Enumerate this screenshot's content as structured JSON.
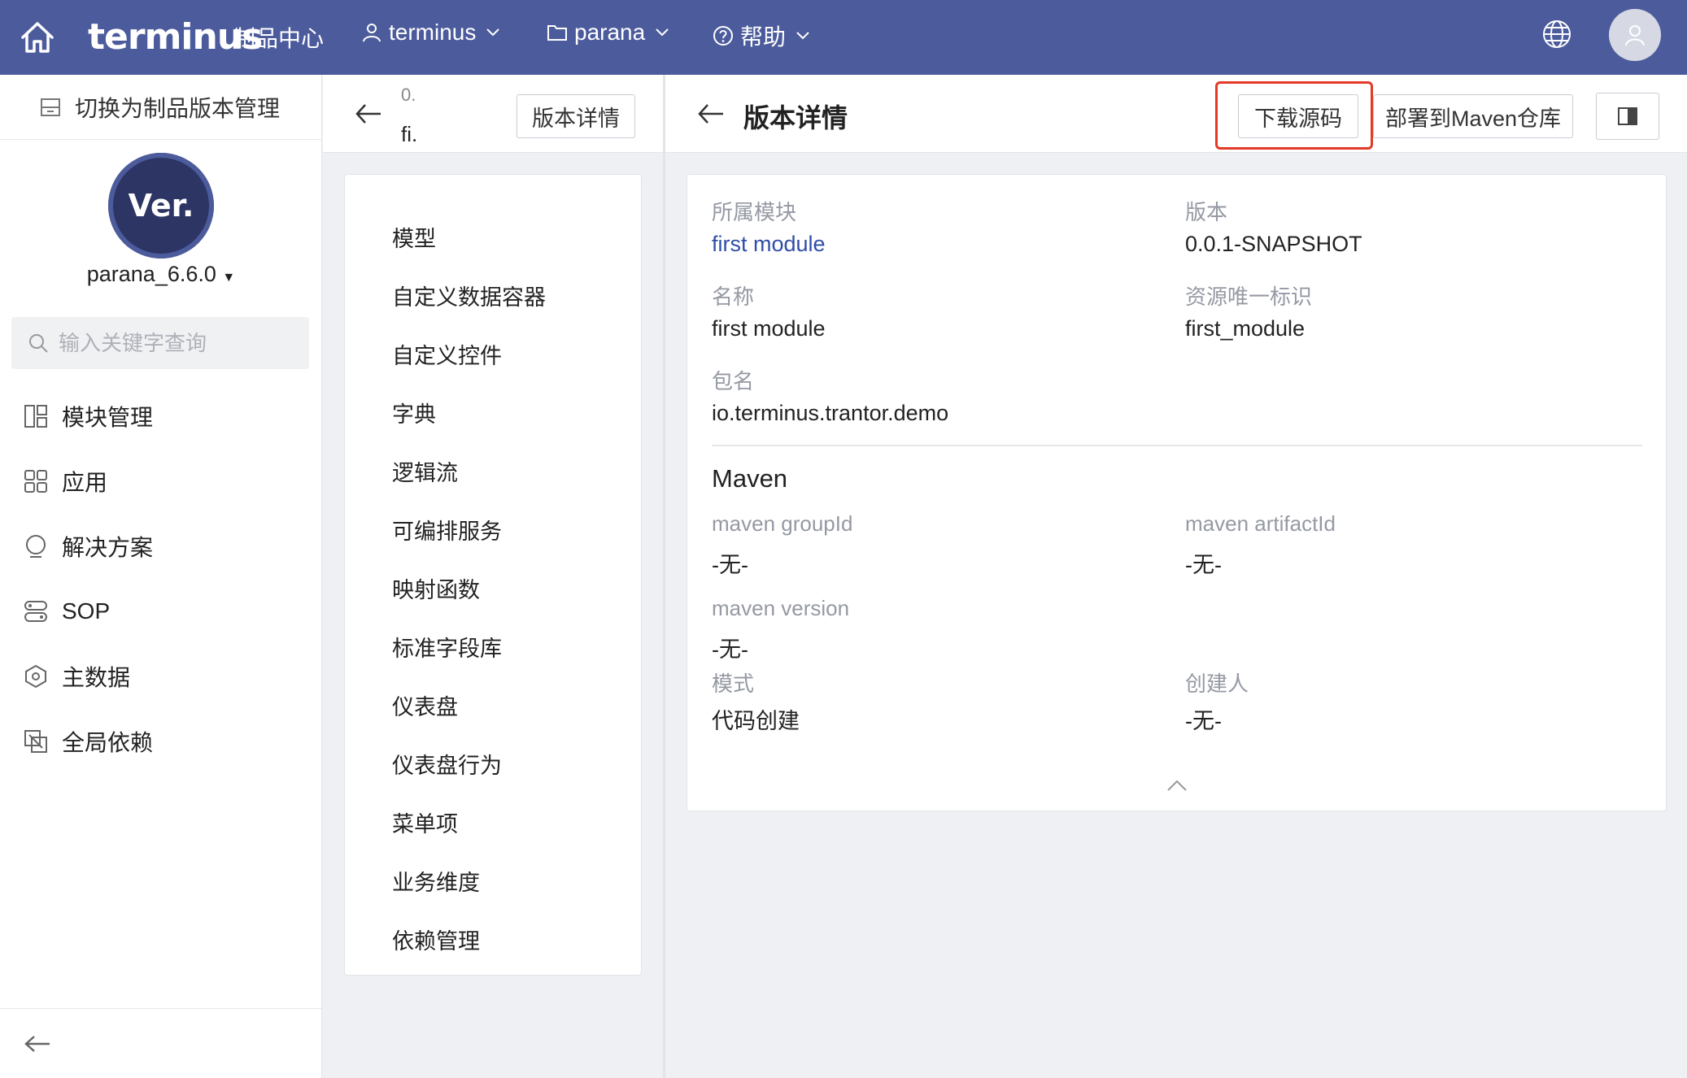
{
  "topbar": {
    "brand": "terminus",
    "brand_sub": "制品中心",
    "nav": [
      {
        "label": "terminus",
        "icon": "user-icon"
      },
      {
        "label": "parana",
        "icon": "folder-icon"
      },
      {
        "label": "帮助",
        "icon": "help-icon"
      }
    ]
  },
  "sidebar": {
    "switch_label": "切换为制品版本管理",
    "logo_text": "Ver.",
    "project_name": "parana_6.6.0",
    "search_placeholder": "输入关键字查询",
    "menu": [
      {
        "label": "模块管理",
        "icon": "module-icon"
      },
      {
        "label": "应用",
        "icon": "apps-icon"
      },
      {
        "label": "解决方案",
        "icon": "solution-icon"
      },
      {
        "label": "SOP",
        "icon": "sop-icon"
      },
      {
        "label": "主数据",
        "icon": "master-data-icon"
      },
      {
        "label": "全局依赖",
        "icon": "global-dependency-icon"
      }
    ]
  },
  "middle": {
    "title_line1": "0.",
    "title_line2": "fi.",
    "detail_button": "版本详情",
    "items": [
      "模型",
      "自定义数据容器",
      "自定义控件",
      "字典",
      "逻辑流",
      "可编排服务",
      "映射函数",
      "标准字段库",
      "仪表盘",
      "仪表盘行为",
      "菜单项",
      "业务维度",
      "依赖管理"
    ]
  },
  "detail": {
    "title": "版本详情",
    "download_button": "下载源码",
    "deploy_button": "部署到Maven仓库",
    "fields": {
      "module_label": "所属模块",
      "module_value": "first module",
      "version_label": "版本",
      "version_value": "0.0.1-SNAPSHOT",
      "name_label": "名称",
      "name_value": "first module",
      "resource_label": "资源唯一标识",
      "resource_value": "first_module",
      "package_label": "包名",
      "package_value": "io.terminus.trantor.demo"
    },
    "maven": {
      "title": "Maven",
      "group_label": "maven groupId",
      "group_value": "-无-",
      "artifact_label": "maven artifactId",
      "artifact_value": "-无-",
      "version_label": "maven version",
      "version_value": "-无-",
      "mode_label": "模式",
      "mode_value": "代码创建",
      "creator_label": "创建人",
      "creator_value": "-无-"
    }
  }
}
